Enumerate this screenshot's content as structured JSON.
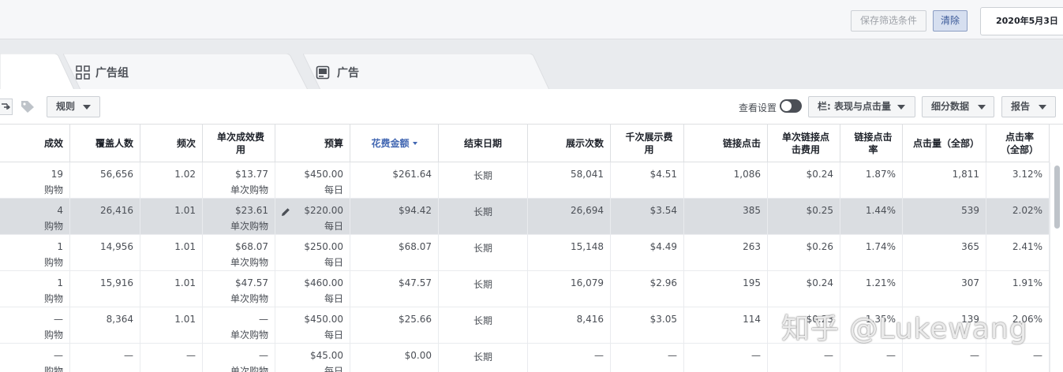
{
  "topbar": {
    "save_filter_label": "保存筛选条件",
    "clear_label": "清除",
    "date_range": "2020年5月3日"
  },
  "tabs": [
    {
      "label": "",
      "icon": "campaign-folder-icon",
      "active": true
    },
    {
      "label": "广告组",
      "icon": "grid-icon",
      "active": false
    },
    {
      "label": "广告",
      "icon": "ad-icon",
      "active": false
    }
  ],
  "toolbar": {
    "rules_label": "规则",
    "view_settings_label": "查看设置",
    "columns_label": "栏: 表现与点击量",
    "breakdown_label": "细分数据",
    "reports_label": "报告"
  },
  "table": {
    "columns": [
      "成效",
      "覆盖人数",
      "频次",
      "单次成效费用",
      "预算",
      "花费金额",
      "结束日期",
      "展示次数",
      "千次展示费用",
      "链接点击",
      "单次链接点击费用",
      "链接点击率",
      "点击量（全部）",
      "点击率（全部）"
    ],
    "sorted_column": "花费金额",
    "rows": [
      {
        "results": "19",
        "results_type": "购物",
        "reach": "56,656",
        "frequency": "1.02",
        "cost_per_result": "$13.77",
        "cpr_type": "单次购物",
        "budget": "$450.00",
        "budget_type": "每日",
        "spent": "$261.64",
        "end_date": "长期",
        "impressions": "58,041",
        "cpm": "$4.51",
        "link_clicks": "1,086",
        "cpc_link": "$0.24",
        "ctr_link": "1.87%",
        "clicks_all": "1,811",
        "ctr_all": "3.12%"
      },
      {
        "results": "4",
        "results_type": "购物",
        "reach": "26,416",
        "frequency": "1.01",
        "cost_per_result": "$23.61",
        "cpr_type": "单次购物",
        "budget": "$220.00",
        "budget_type": "每日",
        "spent": "$94.42",
        "end_date": "长期",
        "impressions": "26,694",
        "cpm": "$3.54",
        "link_clicks": "385",
        "cpc_link": "$0.25",
        "ctr_link": "1.44%",
        "clicks_all": "539",
        "ctr_all": "2.02%"
      },
      {
        "results": "1",
        "results_type": "购物",
        "reach": "14,956",
        "frequency": "1.01",
        "cost_per_result": "$68.07",
        "cpr_type": "单次购物",
        "budget": "$250.00",
        "budget_type": "每日",
        "spent": "$68.07",
        "end_date": "长期",
        "impressions": "15,148",
        "cpm": "$4.49",
        "link_clicks": "263",
        "cpc_link": "$0.26",
        "ctr_link": "1.74%",
        "clicks_all": "365",
        "ctr_all": "2.41%"
      },
      {
        "results": "1",
        "results_type": "购物",
        "reach": "15,916",
        "frequency": "1.01",
        "cost_per_result": "$47.57",
        "cpr_type": "单次购物",
        "budget": "$460.00",
        "budget_type": "每日",
        "spent": "$47.57",
        "end_date": "长期",
        "impressions": "16,079",
        "cpm": "$2.96",
        "link_clicks": "195",
        "cpc_link": "$0.24",
        "ctr_link": "1.21%",
        "clicks_all": "307",
        "ctr_all": "1.91%"
      },
      {
        "results": "—",
        "results_type": "购物",
        "reach": "8,364",
        "frequency": "1.01",
        "cost_per_result": "—",
        "cpr_type": "单次购物",
        "budget": "$450.00",
        "budget_type": "每日",
        "spent": "$25.66",
        "end_date": "长期",
        "impressions": "8,416",
        "cpm": "$3.05",
        "link_clicks": "114",
        "cpc_link": "$0.23",
        "ctr_link": "1.35%",
        "clicks_all": "139",
        "ctr_all": "2.06%"
      },
      {
        "results": "—",
        "results_type": "购物",
        "reach": "—",
        "frequency": "—",
        "cost_per_result": "—",
        "cpr_type": "单次购物",
        "budget": "$45.00",
        "budget_type": "每日",
        "spent": "$0.00",
        "end_date": "长期",
        "impressions": "—",
        "cpm": "—",
        "link_clicks": "—",
        "cpc_link": "—",
        "ctr_link": "—",
        "clicks_all": "—",
        "ctr_all": "—"
      }
    ]
  },
  "watermark": "知乎 @Lukewang"
}
